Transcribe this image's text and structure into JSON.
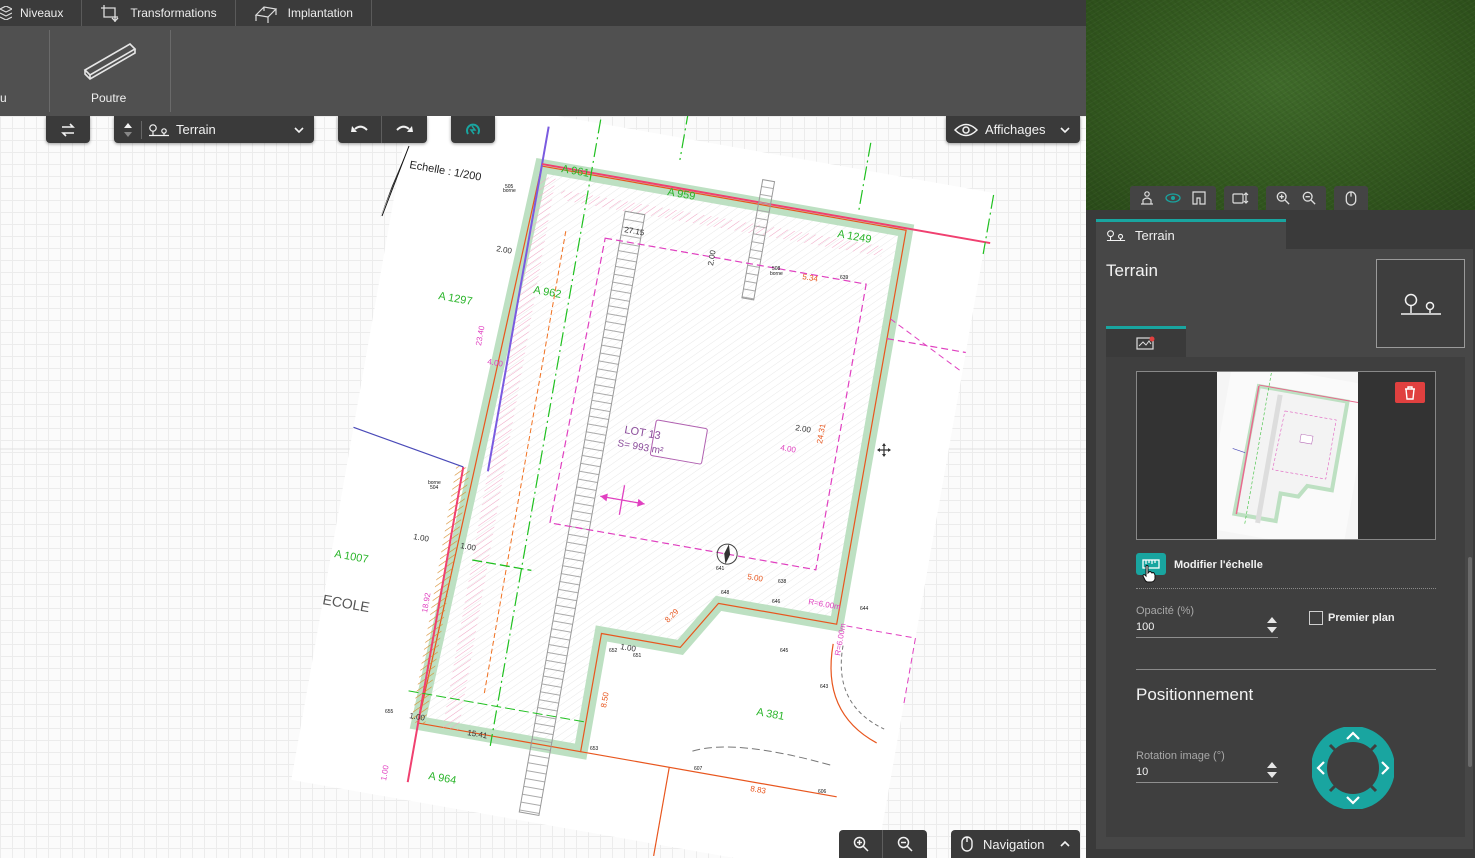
{
  "top_menu": {
    "items": [
      {
        "label": "Niveaux"
      },
      {
        "label": "Transformations"
      },
      {
        "label": "Implantation"
      }
    ]
  },
  "ribbon": {
    "left_cut_label": "u",
    "poutre_label": "Poutre"
  },
  "toolbar": {
    "level_select": "Terrain",
    "display_label": "Affichages",
    "navigation_label": "Navigation"
  },
  "plan": {
    "scale_text": "Echelle : 1/200",
    "parcels": [
      "A 961",
      "A 959",
      "A 1249",
      "A 1297",
      "A 962",
      "A 1007",
      "A 381",
      "A 964"
    ],
    "lot_title": "LOT 13",
    "lot_area": "S= 993 m²",
    "school_label": "ECOLE",
    "dimensions": [
      "2.00",
      "4.00",
      "2.00",
      "1.00",
      "1.00",
      "2.00",
      "4.00",
      "5.00",
      "8.29",
      "1.00",
      "8.50",
      "15.41",
      "8.83",
      "5.34",
      "R=6.00m",
      "R=6.00m",
      "23.40",
      "18.92",
      "24.31",
      "27.15",
      "1.00",
      "1.00"
    ],
    "point_ids": [
      "505",
      "508",
      "639",
      "504",
      "641",
      "646",
      "648",
      "652",
      "651",
      "653",
      "655",
      "607",
      "606",
      "643",
      "644",
      "645",
      "638"
    ],
    "borne_labels": [
      "borne",
      "borne",
      "borne"
    ]
  },
  "panel": {
    "tab_label": "Terrain",
    "title": "Terrain",
    "scale_button_label": "Modifier l'échelle",
    "opacity_label": "Opacité (%)",
    "opacity_value": "100",
    "foreground_label": "Premier plan",
    "foreground_checked": false,
    "positioning_title": "Positionnement",
    "rotation_label": "Rotation image (°)",
    "rotation_value": "10"
  },
  "colors": {
    "accent": "#19a5a0",
    "delete": "#e0403f",
    "panel_bg": "#3a3a3a",
    "ribbon_bg": "#505050"
  },
  "icons": [
    "levels-icon",
    "transform-icon",
    "implantation-icon",
    "beam-icon",
    "swap-icon",
    "updown-icon",
    "terrain-icon",
    "chevron-down-icon",
    "undo-icon",
    "redo-icon",
    "magnet-icon",
    "eye-icon",
    "zoom-in-icon",
    "zoom-out-icon",
    "mouse-icon",
    "chevron-up-icon",
    "walk-icon",
    "orbit-icon",
    "plan-icon",
    "camera-height-icon",
    "trash-icon",
    "ruler-icon",
    "image-layer-icon",
    "arrow-up-icon",
    "arrow-down-icon",
    "arrow-left-icon",
    "arrow-right-icon",
    "move-cursor-icon",
    "hand-cursor-icon"
  ]
}
